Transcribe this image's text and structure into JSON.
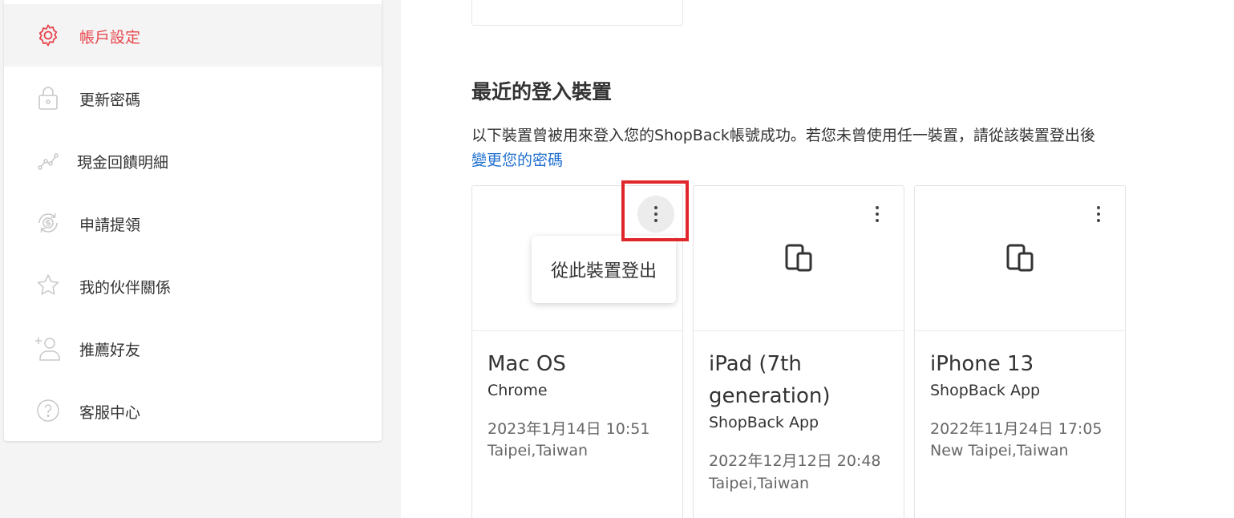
{
  "sidebar": {
    "items": [
      {
        "label": "帳戶設定",
        "icon": "gear-icon",
        "active": true
      },
      {
        "label": "更新密碼",
        "icon": "lock-icon",
        "active": false
      },
      {
        "label": "現金回饋明細",
        "icon": "trend-icon",
        "active": false
      },
      {
        "label": "申請提領",
        "icon": "dollar-refresh-icon",
        "active": false
      },
      {
        "label": "我的伙伴關係",
        "icon": "star-icon",
        "active": false
      },
      {
        "label": "推薦好友",
        "icon": "add-person-icon",
        "active": false
      },
      {
        "label": "客服中心",
        "icon": "question-icon",
        "active": false
      }
    ]
  },
  "main": {
    "title": "最近的登入裝置",
    "description": "以下裝置曾被用來登入您的ShopBack帳號成功。若您未曾使用任一裝置，請從該裝置登出後",
    "change_password_link": "變更您的密碼",
    "devices": [
      {
        "name": "Mac OS",
        "client": "Chrome",
        "timestamp": "2023年1月14日 10:51",
        "location": "Taipei,Taiwan",
        "icon": "device-icon"
      },
      {
        "name": "iPad (7th generation)",
        "client": "ShopBack App",
        "timestamp": "2022年12月12日 20:48",
        "location": "Taipei,Taiwan",
        "icon": "device-icon"
      },
      {
        "name": "iPhone 13",
        "client": "ShopBack App",
        "timestamp": "2022年11月24日 17:05",
        "location": "New Taipei,Taiwan",
        "icon": "device-icon"
      }
    ],
    "popup": {
      "label": "從此裝置登出"
    }
  },
  "colors": {
    "accent": "#e8464d",
    "link": "#1f6fcf",
    "highlight": "#e0262b"
  }
}
